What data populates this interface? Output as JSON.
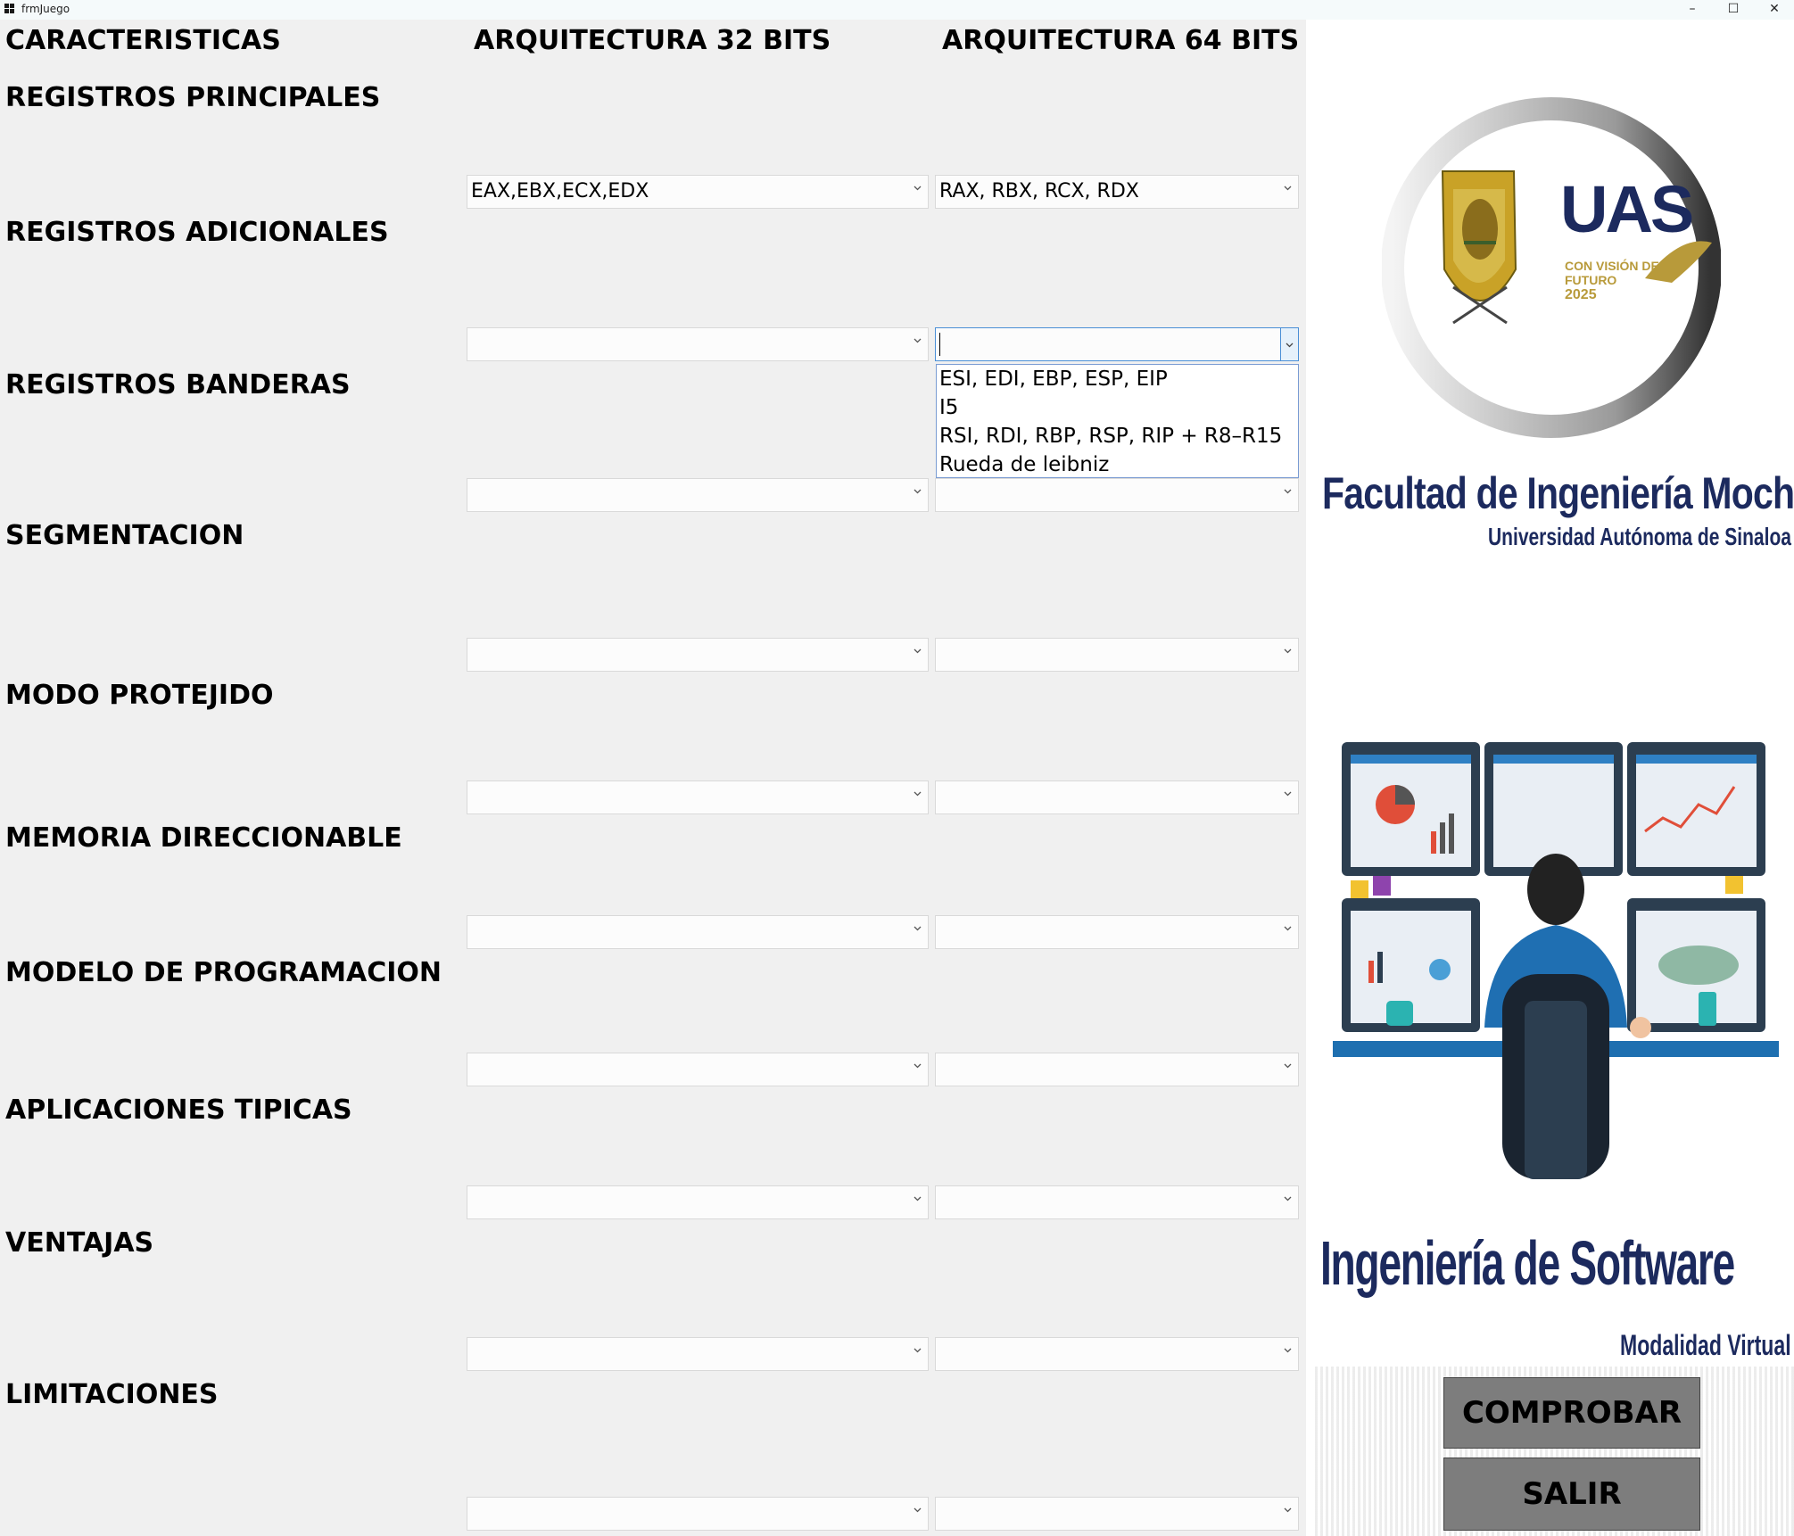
{
  "window": {
    "title": "frmJuego",
    "minimize_icon": "minimize-icon",
    "maximize_icon": "maximize-icon",
    "close_icon": "close-icon"
  },
  "headers": {
    "features": "CARACTERISTICAS",
    "arch32": "ARQUITECTURA 32 BITS",
    "arch64": "ARQUITECTURA 64 BITS"
  },
  "rows": [
    {
      "label": "REGISTROS PRINCIPALES",
      "val32": "EAX,EBX,ECX,EDX",
      "val64": "RAX, RBX, RCX, RDX"
    },
    {
      "label": "REGISTROS ADICIONALES",
      "val32": "",
      "val64": ""
    },
    {
      "label": "REGISTROS BANDERAS",
      "val32": "",
      "val64": ""
    },
    {
      "label": "SEGMENTACION",
      "val32": "",
      "val64": ""
    },
    {
      "label": "MODO PROTEJIDO",
      "val32": "",
      "val64": ""
    },
    {
      "label": "MEMORIA DIRECCIONABLE",
      "val32": "",
      "val64": ""
    },
    {
      "label": "MODELO DE PROGRAMACION",
      "val32": "",
      "val64": ""
    },
    {
      "label": "APLICACIONES TIPICAS",
      "val32": "",
      "val64": ""
    },
    {
      "label": "VENTAJAS",
      "val32": "",
      "val64": ""
    },
    {
      "label": "LIMITACIONES",
      "val32": "",
      "val64": ""
    }
  ],
  "dropdown": {
    "options": [
      "ESI, EDI, EBP, ESP, EIP",
      "I5",
      "RSI, RDI, RBP, RSP, RIP + R8–R15",
      "Rueda de leibniz"
    ]
  },
  "branding": {
    "logo_text": "UAS",
    "logo_subtext_1": "CON VISIÓN DE",
    "logo_subtext_2": "FUTURO",
    "logo_subtext_3": "2025",
    "faculty": "Facultad de Ingeniería Mochis",
    "university": "Universidad Autónoma de Sinaloa",
    "program": "Ingeniería de Software",
    "modality": "Modalidad Virtual"
  },
  "buttons": {
    "check": "COMPROBAR",
    "exit": "SALIR"
  },
  "colors": {
    "logo_blue": "#1c2a5e",
    "logo_gold": "#b89a3a",
    "button_gray": "#7d7d7d",
    "focus_blue": "#4a8fd6"
  }
}
